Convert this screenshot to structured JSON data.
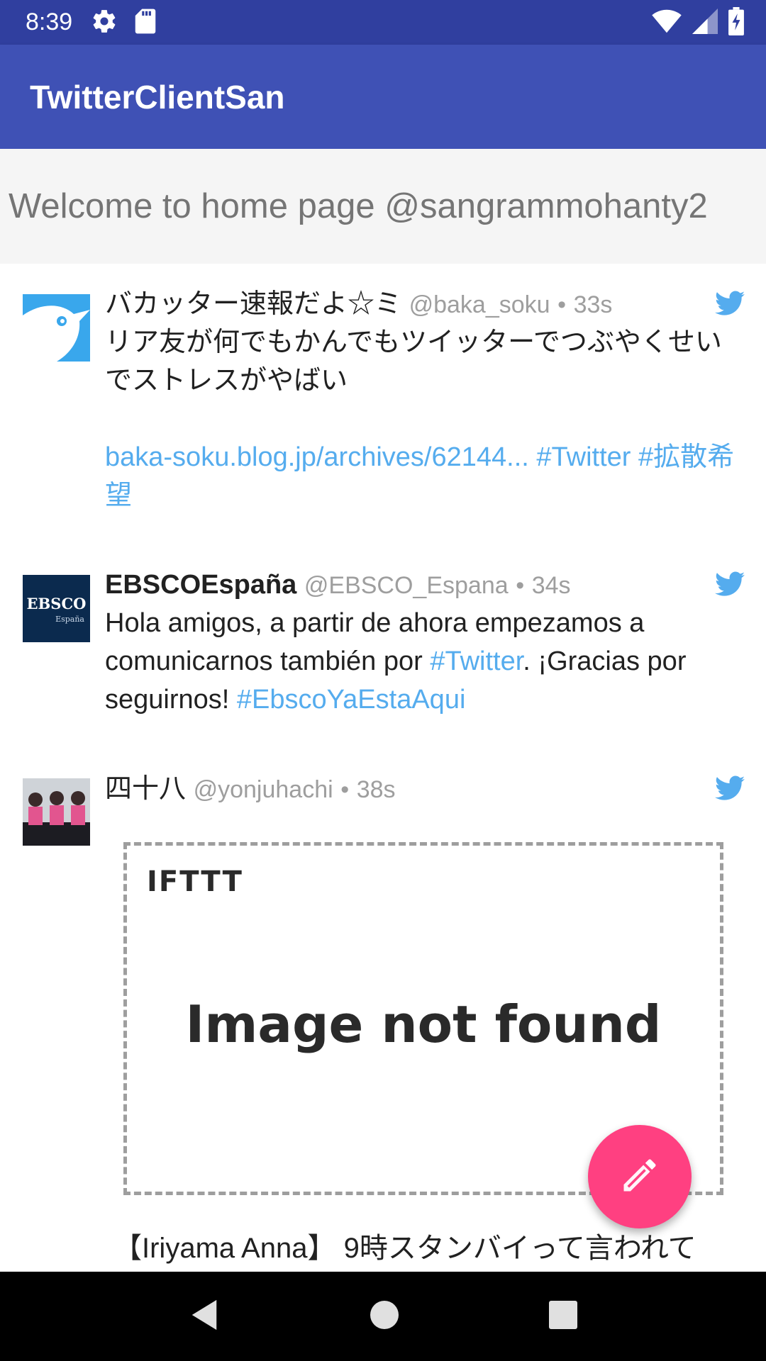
{
  "status_bar": {
    "time": "8:39",
    "icons": [
      "settings-icon",
      "sd-card-icon",
      "wifi-icon",
      "signal-icon",
      "battery-charging-icon"
    ]
  },
  "app_bar": {
    "title": "TwitterClientSan",
    "color": "#3f51b5"
  },
  "welcome": {
    "text": "Welcome to home page @sangrammohanty2"
  },
  "tweets": [
    {
      "name": "バカッター速報だよ☆ミ",
      "handle": "@baka_soku",
      "separator": "•",
      "time": "33s",
      "text": "リア友が何でもかんでもツイッターでつぶやくせいでストレスがやばい",
      "link_line": "baka-soku.blog.jp/archives/62144... #Twitter #拡散希望"
    },
    {
      "name": "EBSCOEspaña",
      "handle": "@EBSCO_Espana",
      "separator": "•",
      "time": "34s",
      "text_1": "Hola amigos, a partir de ahora empezamos a comunicarnos también por ",
      "hashtag_1": "#Twitter",
      "text_2": ". ¡Gracias por seguirnos! ",
      "hashtag_2": "#EbscoYaEstaAqui",
      "avatar_logo": "EBSCO",
      "avatar_sub": "España"
    },
    {
      "name": "四十八",
      "handle": "@yonjuhachi",
      "separator": "•",
      "time": "38s",
      "image_brand": "IFTTT",
      "image_text": "Image not found",
      "text": "【Iriyama Anna】 9時スタンバイって言われて"
    }
  ],
  "fab": {
    "icon": "pencil-icon",
    "color": "#ff4081"
  },
  "nav_bar": {
    "icons": [
      "back-icon",
      "home-icon",
      "recents-icon"
    ]
  }
}
